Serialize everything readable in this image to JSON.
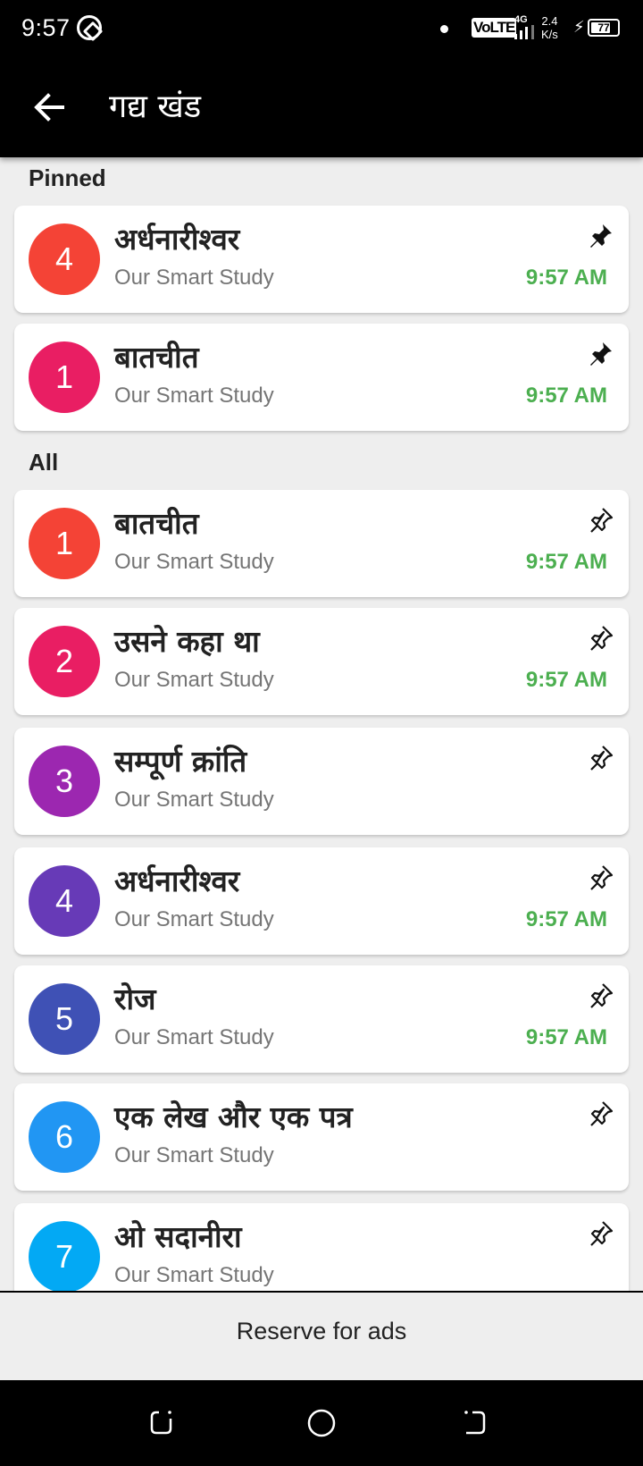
{
  "status_bar": {
    "time": "9:57",
    "network": "VoLTE",
    "network_gen": "4G",
    "speed_value": "2.4",
    "speed_unit": "K/s",
    "battery": "77",
    "battery_level": 0.77
  },
  "app_bar": {
    "title": "गद्य खंड",
    "back_icon": "arrow-left-icon"
  },
  "sections": {
    "pinned_label": "Pinned",
    "all_label": "All"
  },
  "pinned": [
    {
      "number": "4",
      "title": "अर्धनारीश्वर",
      "subtitle": "Our Smart Study",
      "time": "9:57 AM",
      "color": "#f44336",
      "pinned": true
    },
    {
      "number": "1",
      "title": "बातचीत",
      "subtitle": "Our Smart Study",
      "time": "9:57 AM",
      "color": "#e91e63",
      "pinned": true
    }
  ],
  "all": [
    {
      "number": "1",
      "title": "बातचीत",
      "subtitle": "Our Smart Study",
      "time": "9:57 AM",
      "color": "#f44336",
      "pinned": false
    },
    {
      "number": "2",
      "title": "उसने कहा था",
      "subtitle": "Our Smart Study",
      "time": "9:57 AM",
      "color": "#e91e63",
      "pinned": false
    },
    {
      "number": "3",
      "title": "सम्पूर्ण क्रांति",
      "subtitle": "Our Smart Study",
      "time": "",
      "color": "#9c27b0",
      "pinned": false
    },
    {
      "number": "4",
      "title": "अर्धनारीश्वर",
      "subtitle": "Our Smart Study",
      "time": "9:57 AM",
      "color": "#673ab7",
      "pinned": false
    },
    {
      "number": "5",
      "title": "रोज",
      "subtitle": "Our Smart Study",
      "time": "9:57 AM",
      "color": "#3f51b5",
      "pinned": false
    },
    {
      "number": "6",
      "title": "एक लेख और एक पत्र",
      "subtitle": "Our Smart Study",
      "time": "",
      "color": "#2196f3",
      "pinned": false
    },
    {
      "number": "7",
      "title": "ओ सदानीरा",
      "subtitle": "Our Smart Study",
      "time": "",
      "color": "#03a9f4",
      "pinned": false
    }
  ],
  "ad_bar": {
    "text": "Reserve for ads"
  },
  "colors": {
    "time_green": "#4caf50",
    "background": "#eeeeee",
    "app_bar": "#000000"
  }
}
